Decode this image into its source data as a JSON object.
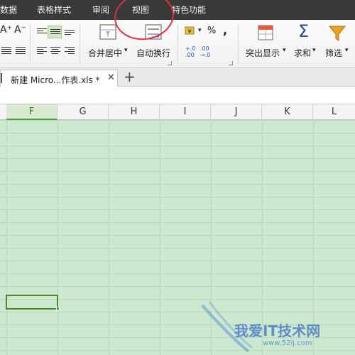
{
  "menu": {
    "items": [
      "数据",
      "表格样式",
      "审阅",
      "视图",
      "特色功能"
    ]
  },
  "ribbon": {
    "font_grow": "A⁺",
    "font_shrink": "A⁻",
    "merge_center": "合并居中",
    "wrap_text": "自动换行",
    "percent": "%",
    "comma": ",",
    "decimal_add": "+.0\n.00",
    "decimal_sub": ".00\n→.0",
    "highlight": "突出显示",
    "sum": "求和",
    "filter": "筛选",
    "dropdown": "▾"
  },
  "tabs": {
    "doc_tab": "新建 Micro...作表.xls *",
    "close": "✕",
    "new_tab": "+"
  },
  "columns": [
    "F",
    "G",
    "H",
    "I",
    "J",
    "K",
    "L"
  ],
  "selected_column": "F",
  "watermark": {
    "text": "我爱IT技术网",
    "url": "www.52ij.com"
  },
  "colors": {
    "menu_bg": "#3a3a3a",
    "grid_bg": "#cce8cf",
    "active_cell": "#4a8a2e",
    "annotation": "#e0303a"
  }
}
